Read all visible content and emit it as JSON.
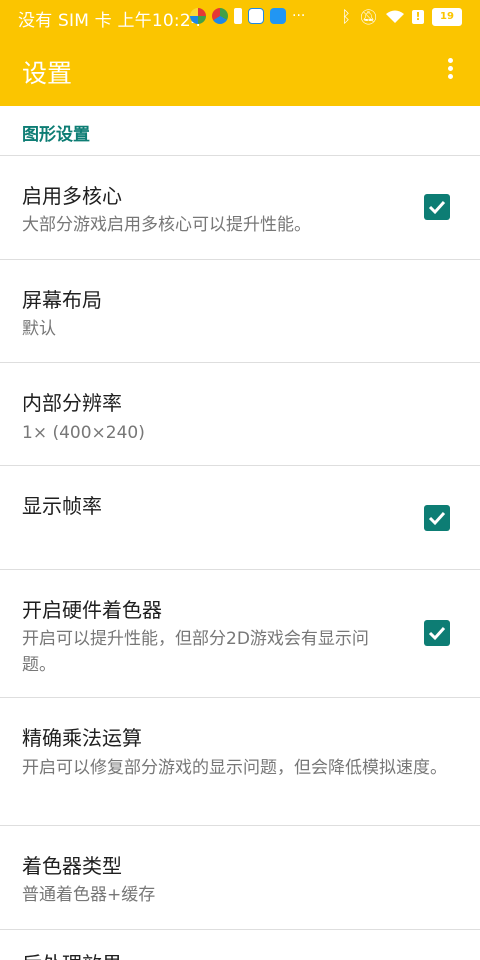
{
  "status_bar": {
    "left_text": "没有 SIM 卡 上午10:24",
    "more_dots": "···",
    "battery": "19",
    "icons": [
      "app-icon-1",
      "app-icon-2",
      "battery-saver-icon",
      "music-app-icon",
      "message-app-icon",
      "bluetooth-icon",
      "mute-icon",
      "wifi-icon",
      "warning-icon",
      "battery-icon"
    ]
  },
  "app_bar": {
    "title": "设置",
    "menu_icon": "more-vert-icon"
  },
  "section": {
    "title": "图形设置"
  },
  "items": [
    {
      "title": "启用多核心",
      "subtitle": "大部分游戏启用多核心可以提升性能。",
      "checked": true
    },
    {
      "title": "屏幕布局",
      "subtitle": "默认"
    },
    {
      "title": "内部分辨率",
      "subtitle": "1× (400×240)"
    },
    {
      "title": "显示帧率",
      "subtitle": "",
      "checked": true
    },
    {
      "title": "开启硬件着色器",
      "subtitle": "开启可以提升性能，但部分2D游戏会有显示问题。",
      "checked": true
    },
    {
      "title": "精确乘法运算",
      "subtitle": "开启可以修复部分游戏的显示问题，但会降低模拟速度。"
    },
    {
      "title": "着色器类型",
      "subtitle": "普通着色器+缓存"
    },
    {
      "title": "后处理效果",
      "subtitle": ""
    }
  ],
  "colors": {
    "app_bar": "#fbc500",
    "accent": "#0d7d74",
    "divider": "#dedede"
  }
}
